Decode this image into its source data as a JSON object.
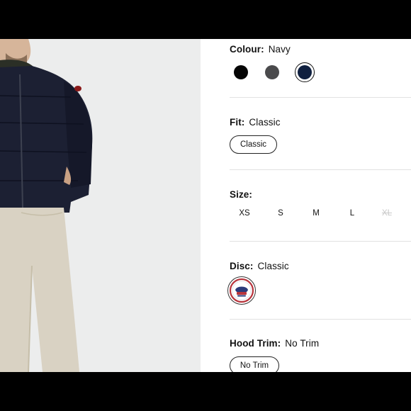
{
  "colour": {
    "label": "Colour:",
    "value": "Navy",
    "swatches": [
      {
        "name": "Black",
        "color": "#050505",
        "selected": false
      },
      {
        "name": "Graphite",
        "color": "#4a4a4c",
        "selected": false
      },
      {
        "name": "Navy",
        "color": "#0f1f3f",
        "selected": true
      }
    ]
  },
  "fit": {
    "label": "Fit:",
    "value": "Classic",
    "option": "Classic"
  },
  "size": {
    "label": "Size:",
    "options": [
      {
        "label": "XS",
        "available": true
      },
      {
        "label": "S",
        "available": true
      },
      {
        "label": "M",
        "available": true
      },
      {
        "label": "L",
        "available": true
      },
      {
        "label": "XL",
        "available": false
      }
    ]
  },
  "disc": {
    "label": "Disc:",
    "value": "Classic"
  },
  "hood_trim": {
    "label": "Hood Trim:",
    "value": "No Trim",
    "option": "No Trim"
  }
}
